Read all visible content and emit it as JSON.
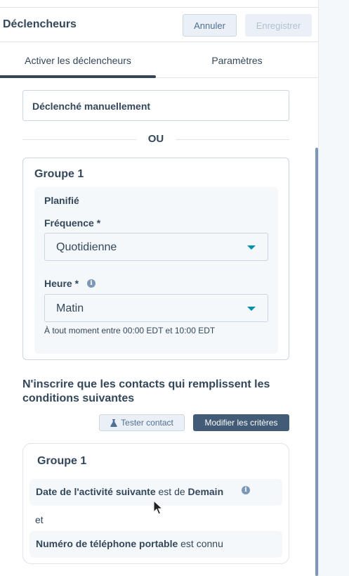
{
  "header": {
    "title": "Déclencheurs",
    "cancel_label": "Annuler",
    "save_label": "Enregistrer"
  },
  "tabs": [
    {
      "label": "Activer les déclencheurs",
      "active": true
    },
    {
      "label": "Paramètres",
      "active": false
    }
  ],
  "manual_trigger": {
    "label": "Déclenché manuellement"
  },
  "separator": {
    "label": "OU"
  },
  "schedule_group": {
    "title": "Groupe 1",
    "section_label": "Planifié",
    "frequency": {
      "label": "Fréquence *",
      "value": "Quotidienne"
    },
    "time": {
      "label": "Heure *",
      "value": "Matin",
      "hint": "À tout moment entre 00:00 EDT et 10:00 EDT"
    }
  },
  "enrollment": {
    "title": "N'inscrire que les contacts qui remplissent les conditions suivantes",
    "test_label": "Tester contact",
    "edit_label": "Modifier les critères"
  },
  "criteria_group": {
    "title": "Groupe 1",
    "criteria": [
      {
        "property": "Date de l'activité suivante",
        "operator": "est de",
        "value": "Demain",
        "has_info": true
      },
      {
        "property": "Numéro de téléphone portable",
        "operator": "est connu",
        "value": "",
        "has_info": false
      }
    ],
    "joiner": "et"
  },
  "colors": {
    "text": "#33475b",
    "accent_caret": "#0091ae",
    "primary_button": "#425b76",
    "panel_bg": "#f5f8fa",
    "border": "#cbd6e2"
  }
}
